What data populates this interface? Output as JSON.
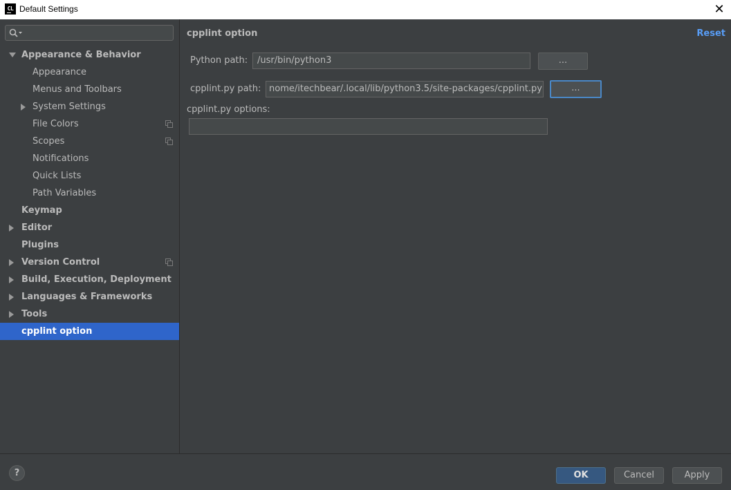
{
  "window": {
    "icon_text": "CL",
    "title": "Default Settings",
    "close_glyph": "✕"
  },
  "search": {
    "placeholder": "",
    "icon": "search-icon"
  },
  "sidebar": {
    "items": [
      {
        "label": "Appearance & Behavior",
        "bold": true,
        "level": 0,
        "arrow": "down",
        "copy": false
      },
      {
        "label": "Appearance",
        "bold": false,
        "level": 1,
        "arrow": "",
        "copy": false
      },
      {
        "label": "Menus and Toolbars",
        "bold": false,
        "level": 1,
        "arrow": "",
        "copy": false
      },
      {
        "label": "System Settings",
        "bold": false,
        "level": 1,
        "arrow": "right",
        "copy": false
      },
      {
        "label": "File Colors",
        "bold": false,
        "level": 1,
        "arrow": "",
        "copy": true
      },
      {
        "label": "Scopes",
        "bold": false,
        "level": 1,
        "arrow": "",
        "copy": true
      },
      {
        "label": "Notifications",
        "bold": false,
        "level": 1,
        "arrow": "",
        "copy": false
      },
      {
        "label": "Quick Lists",
        "bold": false,
        "level": 1,
        "arrow": "",
        "copy": false
      },
      {
        "label": "Path Variables",
        "bold": false,
        "level": 1,
        "arrow": "",
        "copy": false
      },
      {
        "label": "Keymap",
        "bold": true,
        "level": 0,
        "arrow": "",
        "copy": false
      },
      {
        "label": "Editor",
        "bold": true,
        "level": 0,
        "arrow": "right",
        "copy": false
      },
      {
        "label": "Plugins",
        "bold": true,
        "level": 0,
        "arrow": "",
        "copy": false
      },
      {
        "label": "Version Control",
        "bold": true,
        "level": 0,
        "arrow": "right",
        "copy": true
      },
      {
        "label": "Build, Execution, Deployment",
        "bold": true,
        "level": 0,
        "arrow": "right",
        "copy": false
      },
      {
        "label": "Languages & Frameworks",
        "bold": true,
        "level": 0,
        "arrow": "right",
        "copy": false
      },
      {
        "label": "Tools",
        "bold": true,
        "level": 0,
        "arrow": "right",
        "copy": false
      },
      {
        "label": "cpplint option",
        "bold": true,
        "level": 0,
        "arrow": "",
        "copy": false,
        "selected": true
      }
    ]
  },
  "content": {
    "title": "cpplint option",
    "reset_label": "Reset",
    "python_path_label": "Python path:",
    "python_path_value": "/usr/bin/python3",
    "cpplint_path_label": "cpplint.py path:",
    "cpplint_path_value": "nome/itechbear/.local/lib/python3.5/site-packages/cpplint.py",
    "options_label": "cpplint.py options:",
    "options_value": "",
    "browse_label": "..."
  },
  "footer": {
    "help_label": "?",
    "ok_label": "OK",
    "cancel_label": "Cancel",
    "apply_label": "Apply"
  },
  "colors": {
    "background": "#3c3f41",
    "selection": "#2f65ca",
    "link": "#589df6",
    "primary_button": "#365880",
    "focus_border": "#4a88c7"
  }
}
